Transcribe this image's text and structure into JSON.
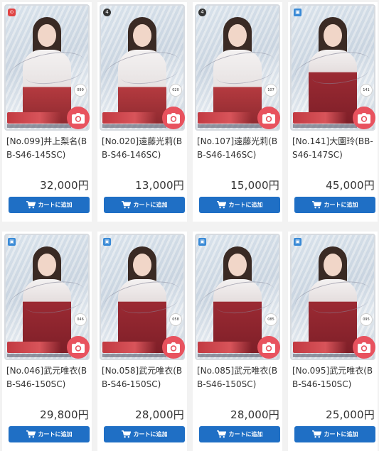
{
  "products": [
    {
      "name": "[No.099]井上梨名(BB-S46-145SC)",
      "price": "32,000円",
      "cart_label": "カートに追加",
      "badge": "⊙",
      "badge_style": "red",
      "card_num": "099",
      "outfit": "red"
    },
    {
      "name": "[No.020]遠藤光莉(BB-S46-146SC)",
      "price": "13,000円",
      "cart_label": "カートに追加",
      "badge": "4",
      "badge_style": "dark",
      "card_num": "020",
      "outfit": "red"
    },
    {
      "name": "[No.107]遠藤光莉(BB-S46-146SC)",
      "price": "15,000円",
      "cart_label": "カートに追加",
      "badge": "4",
      "badge_style": "dark",
      "card_num": "107",
      "outfit": "red"
    },
    {
      "name": "[No.141]大園玲(BB-S46-147SC)",
      "price": "45,000円",
      "cart_label": "カートに追加",
      "badge": "▣",
      "badge_style": "blue",
      "card_num": "141",
      "outfit": "darkred"
    },
    {
      "name": "[No.046]武元唯衣(BB-S46-150SC)",
      "price": "29,800円",
      "cart_label": "カートに追加",
      "badge": "▣",
      "badge_style": "blue",
      "card_num": "046",
      "outfit": "darkred"
    },
    {
      "name": "[No.058]武元唯衣(BB-S46-150SC)",
      "price": "28,000円",
      "cart_label": "カートに追加",
      "badge": "▣",
      "badge_style": "blue",
      "card_num": "058",
      "outfit": "darkred"
    },
    {
      "name": "[No.085]武元唯衣(BB-S46-150SC)",
      "price": "28,000円",
      "cart_label": "カートに追加",
      "badge": "▣",
      "badge_style": "blue",
      "card_num": "085",
      "outfit": "darkred"
    },
    {
      "name": "[No.095]武元唯衣(BB-S46-150SC)",
      "price": "25,000円",
      "cart_label": "カートに追加",
      "badge": "▣",
      "badge_style": "blue",
      "card_num": "095",
      "outfit": "darkred"
    }
  ],
  "icons": {
    "camera": "camera-icon",
    "cart": "cart-icon"
  },
  "colors": {
    "cart_button": "#1f6fc5",
    "camera_badge": "#e8525e",
    "page_bg": "#f2f2f2"
  }
}
